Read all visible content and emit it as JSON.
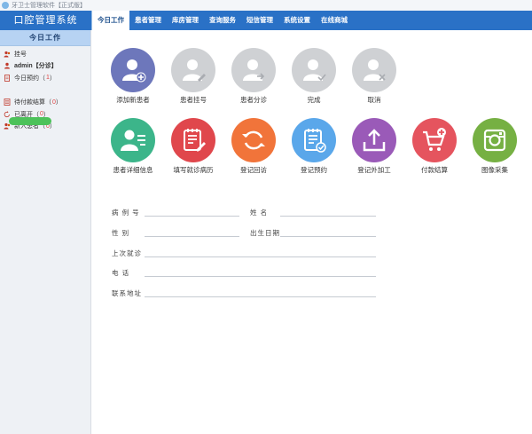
{
  "window": {
    "title": "牙卫士管理软件【正式版】"
  },
  "brand": "口腔管理系统",
  "nav": {
    "tabs": [
      {
        "label": "今日工作",
        "active": true
      },
      {
        "label": "患者管理"
      },
      {
        "label": "库房管理"
      },
      {
        "label": "查询服务"
      },
      {
        "label": "短信管理"
      },
      {
        "label": "系统设置"
      },
      {
        "label": "在线商城"
      }
    ]
  },
  "sidebar": {
    "header": "今日工作",
    "items": [
      {
        "label": "挂号",
        "icon": "user-icon"
      },
      {
        "label": "admin【分诊】",
        "icon": "user-icon"
      },
      {
        "label": "今日预约（",
        "count": "1",
        "close": "）",
        "icon": "document-icon"
      },
      {
        "label": "待付款结算（",
        "count": "0",
        "close": "）",
        "icon": "ledger-icon"
      },
      {
        "label": "已离开（",
        "count": "0",
        "close": "）",
        "icon": "exit-icon"
      },
      {
        "label": "新入患者（",
        "count": "0",
        "close": "）",
        "icon": "user-icon"
      }
    ]
  },
  "actions_row1": [
    {
      "label": "添加新患者",
      "color": "#6d77bb",
      "icon": "user-add-icon"
    },
    {
      "label": "患者挂号",
      "color": "#cfd1d4",
      "icon": "user-edit-icon"
    },
    {
      "label": "患者分诊",
      "color": "#cfd1d4",
      "icon": "user-forward-icon"
    },
    {
      "label": "完成",
      "color": "#cfd1d4",
      "icon": "user-check-icon"
    },
    {
      "label": "取消",
      "color": "#cfd1d4",
      "icon": "user-cancel-icon"
    }
  ],
  "actions_row2": [
    {
      "label": "患者详细信息",
      "color": "#3cb58a",
      "icon": "user-detail-icon"
    },
    {
      "label": "填写就诊病历",
      "color": "#e0474c",
      "icon": "medical-record-icon"
    },
    {
      "label": "登记回访",
      "color": "#f1743a",
      "icon": "refresh-icon"
    },
    {
      "label": "登记预约",
      "color": "#5aa7ea",
      "icon": "appointment-icon"
    },
    {
      "label": "登记外加工",
      "color": "#9a5ab8",
      "icon": "upload-icon"
    },
    {
      "label": "付款结算",
      "color": "#e5545e",
      "icon": "cart-add-icon"
    },
    {
      "label": "图像采集",
      "color": "#76b043",
      "icon": "camera-icon"
    }
  ],
  "form": {
    "case_no": "病 例 号",
    "name": "姓  名",
    "gender": "性  别",
    "birthdate": "出生日期",
    "last_visit": "上次就诊",
    "phone": "电  话",
    "address": "联系地址"
  }
}
